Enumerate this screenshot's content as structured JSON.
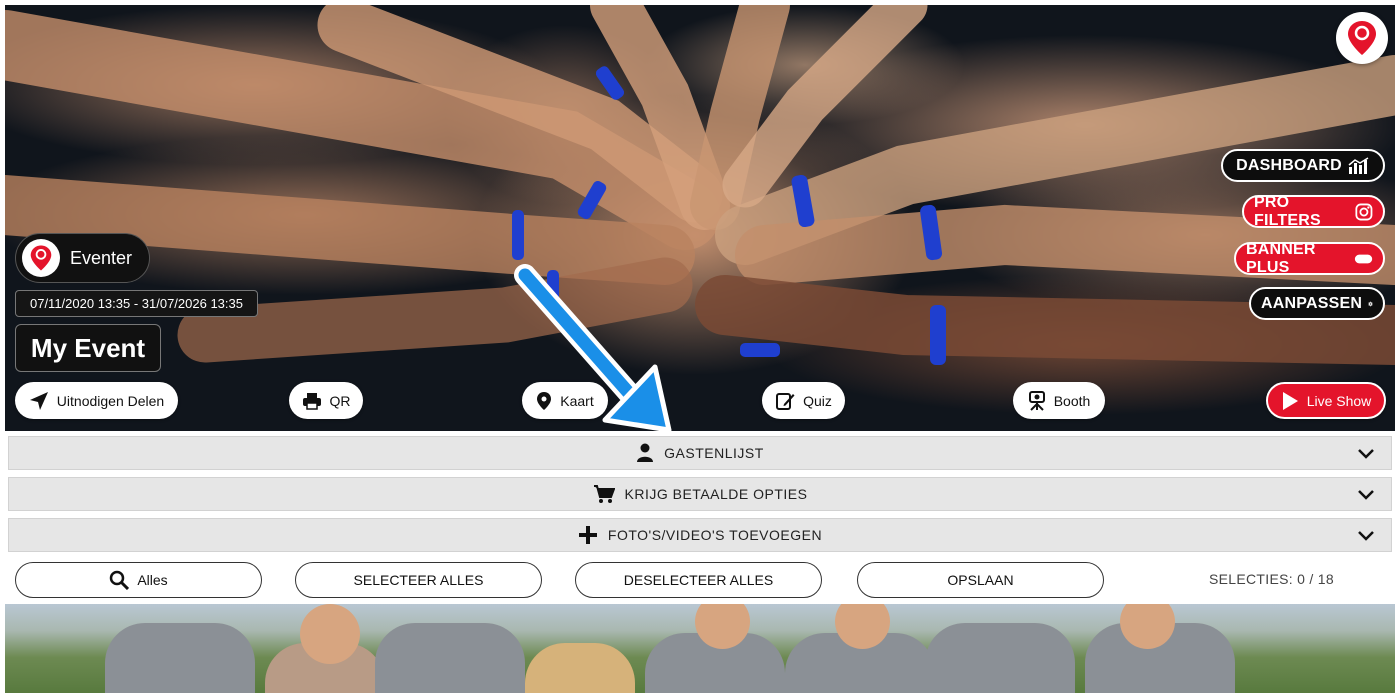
{
  "app": {
    "eventer_label": "Eventer",
    "date_range": "07/11/2020 13:35 - 31/07/2026 13:35",
    "event_title": "My Event"
  },
  "side_actions": {
    "dashboard": "DASHBOARD",
    "pro_filters": "PRO FILTERS",
    "banner_plus": "BANNER PLUS",
    "aanpassen": "AANPASSEN"
  },
  "quick_actions": {
    "invite": "Uitnodigen Delen",
    "qr": "QR",
    "kaart": "Kaart",
    "quiz": "Quiz",
    "booth": "Booth",
    "live_show": "Live Show"
  },
  "accordions": {
    "guest_list": "GASTENLIJST",
    "paid_options": "KRIJG BETAALDE OPTIES",
    "add_media": "FOTO'S/VIDEO'S TOEVOEGEN"
  },
  "toolbar": {
    "filter_all": "Alles",
    "select_all": "SELECTEER ALLES",
    "deselect_all": "DESELECTEER ALLES",
    "save": "OPSLAAN",
    "selections": "SELECTIES: 0 / 18"
  },
  "colors": {
    "brand_red": "#e4142b",
    "annotation_arrow": "#1a8fe8",
    "accordion_bg": "#e6e6e6"
  },
  "icons": {
    "dashboard": "bar-chart-icon",
    "pro_filters": "instagram-icon",
    "banner_plus": "toggle-icon",
    "aanpassen": "gear-icon",
    "invite": "send-icon",
    "qr": "printer-icon",
    "kaart": "map-pin-icon",
    "quiz": "edit-icon",
    "booth": "camera-booth-icon",
    "live_show": "play-icon",
    "guest_list": "user-icon",
    "paid_options": "cart-icon",
    "add_media": "plus-icon",
    "filter_all": "search-icon"
  }
}
